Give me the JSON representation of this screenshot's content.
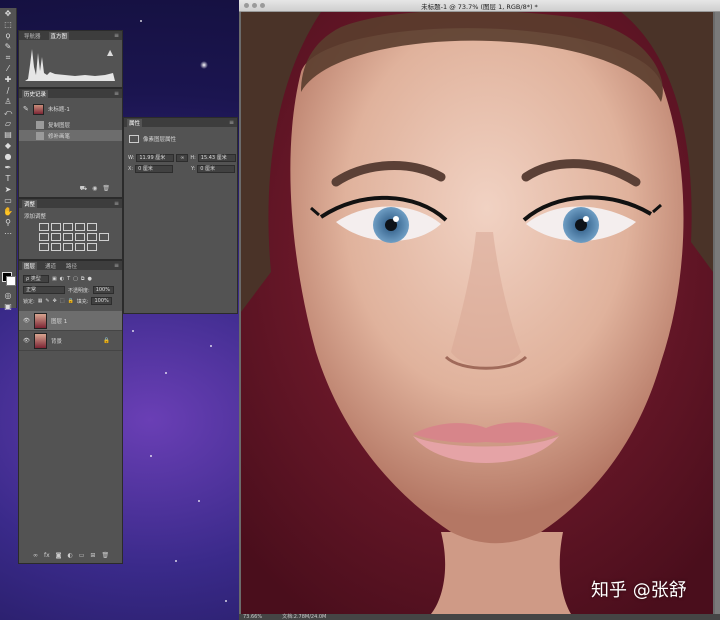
{
  "document": {
    "title": "未标题-1 @ 73.7% (图层 1, RGB/8*) *",
    "zoom": "73.66%",
    "doc_info": "文档:2.78M/24.0M",
    "watermark": "知乎 @张舒"
  },
  "histogram_panel": {
    "tabs": [
      "导航器",
      "直方图"
    ],
    "active_tab": "直方图"
  },
  "history_panel": {
    "tab": "历史记录",
    "snapshot": "未标题-1",
    "states": [
      "复制图层",
      "修补画笔"
    ],
    "selected_state": "修补画笔"
  },
  "adjustments_panel": {
    "tab": "调整",
    "header": "添加调整"
  },
  "properties_panel": {
    "tab": "属性",
    "header": "像素图层属性",
    "w_label": "W:",
    "w_value": "11.99 厘米",
    "h_label": "H:",
    "h_value": "15.43 厘米",
    "x_label": "X:",
    "x_value": "0 厘米",
    "y_label": "Y:",
    "y_value": "0 厘米",
    "link_icon": "link-icon"
  },
  "layers_panel": {
    "tabs": [
      "图层",
      "通道",
      "路径"
    ],
    "active_tab": "图层",
    "filter_kind": "ρ 类型",
    "blend_mode": "正常",
    "opacity_label": "不透明度:",
    "opacity_value": "100%",
    "lock_label": "锁定:",
    "fill_label": "填充:",
    "fill_value": "100%",
    "layers": [
      {
        "name": "图层 1",
        "selected": true,
        "locked": false
      },
      {
        "name": "背景",
        "selected": false,
        "locked": true
      }
    ],
    "bottom_icons": [
      "link-icon",
      "fx-icon",
      "mask-icon",
      "adjustment-icon",
      "folder-icon",
      "new-layer-icon",
      "trash-icon"
    ]
  },
  "colors": {
    "panel": "#535353",
    "panel_dark": "#3d3d3d",
    "selection": "#6d6d6d",
    "backdrop": "#6b1a2a"
  }
}
